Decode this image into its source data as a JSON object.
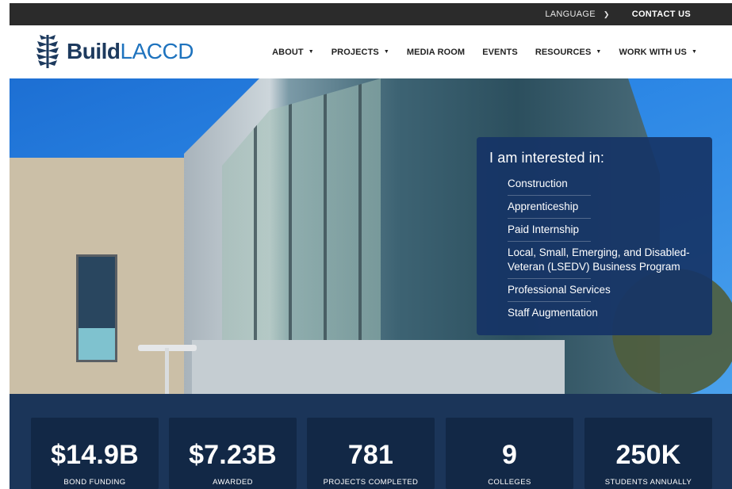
{
  "topbar": {
    "language_label": "LANGUAGE",
    "contact_label": "CONTACT US"
  },
  "header": {
    "logo_icon": "wheat-sheaf-icon",
    "logo_text_bold": "Build",
    "logo_text_light": "LACCD",
    "nav": [
      {
        "label": "ABOUT",
        "dropdown": true
      },
      {
        "label": "PROJECTS",
        "dropdown": true
      },
      {
        "label": "MEDIA ROOM",
        "dropdown": false
      },
      {
        "label": "EVENTS",
        "dropdown": false
      },
      {
        "label": "RESOURCES",
        "dropdown": true
      },
      {
        "label": "WORK WITH US",
        "dropdown": true
      }
    ]
  },
  "panel": {
    "title": "I am interested in:",
    "items": [
      "Construction",
      "Apprenticeship",
      "Paid Internship",
      "Local, Small, Emerging, and Disabled-Veteran (LSEDV) Business Program",
      "Professional Services",
      "Staff Augmentation"
    ]
  },
  "stats": [
    {
      "value": "$14.9B",
      "label": "BOND FUNDING"
    },
    {
      "value": "$7.23B",
      "label": "AWARDED"
    },
    {
      "value": "781",
      "label": "PROJECTS COMPLETED"
    },
    {
      "value": "9",
      "label": "COLLEGES"
    },
    {
      "value": "250K",
      "label": "STUDENTS ANNUALLY"
    }
  ],
  "colors": {
    "topbar_bg": "#2b2b2b",
    "brand_navy": "#1d3a5e",
    "brand_blue": "#1e73be",
    "panel_bg": "#163466",
    "stats_bg": "#1b3559",
    "stat_card_bg": "#122846"
  }
}
